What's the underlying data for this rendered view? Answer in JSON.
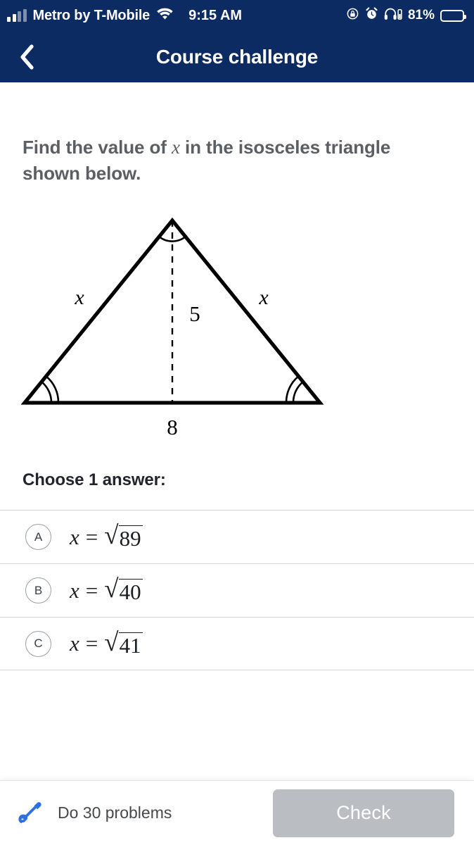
{
  "status_bar": {
    "carrier": "Metro by T-Mobile",
    "time": "9:15 AM",
    "battery_percent": "81%",
    "icons": [
      "signal-bars-icon",
      "wifi-icon",
      "rotation-lock-icon",
      "alarm-clock-icon",
      "headphones-icon",
      "battery-icon"
    ],
    "battery_color": "#ffd60a"
  },
  "nav": {
    "title": "Course challenge",
    "back_label": "‹",
    "background_color": "#0d2b63"
  },
  "question": {
    "part1": "Find the value of ",
    "variable": "x",
    "part2": " in the isosceles triangle shown below."
  },
  "figure": {
    "type": "isosceles-triangle-diagram",
    "left_side_label": "x",
    "right_side_label": "x",
    "altitude_label": "5",
    "base_label": "8",
    "apex_marking": "single-arc",
    "base_angle_markings": "double-arc",
    "altitude_style": "dashed"
  },
  "answers": {
    "prompt": "Choose 1 answer:",
    "options": [
      {
        "letter": "A",
        "variable": "x",
        "equals": "=",
        "radicand": "89"
      },
      {
        "letter": "B",
        "variable": "x",
        "equals": "=",
        "radicand": "40"
      },
      {
        "letter": "C",
        "variable": "x",
        "equals": "=",
        "radicand": "41"
      }
    ]
  },
  "footer": {
    "practice_label": "Do 30 problems",
    "practice_icon": "pencil-scribble-icon",
    "check_label": "Check",
    "check_color": "#babdc2",
    "icon_color": "#2f6fe4"
  }
}
